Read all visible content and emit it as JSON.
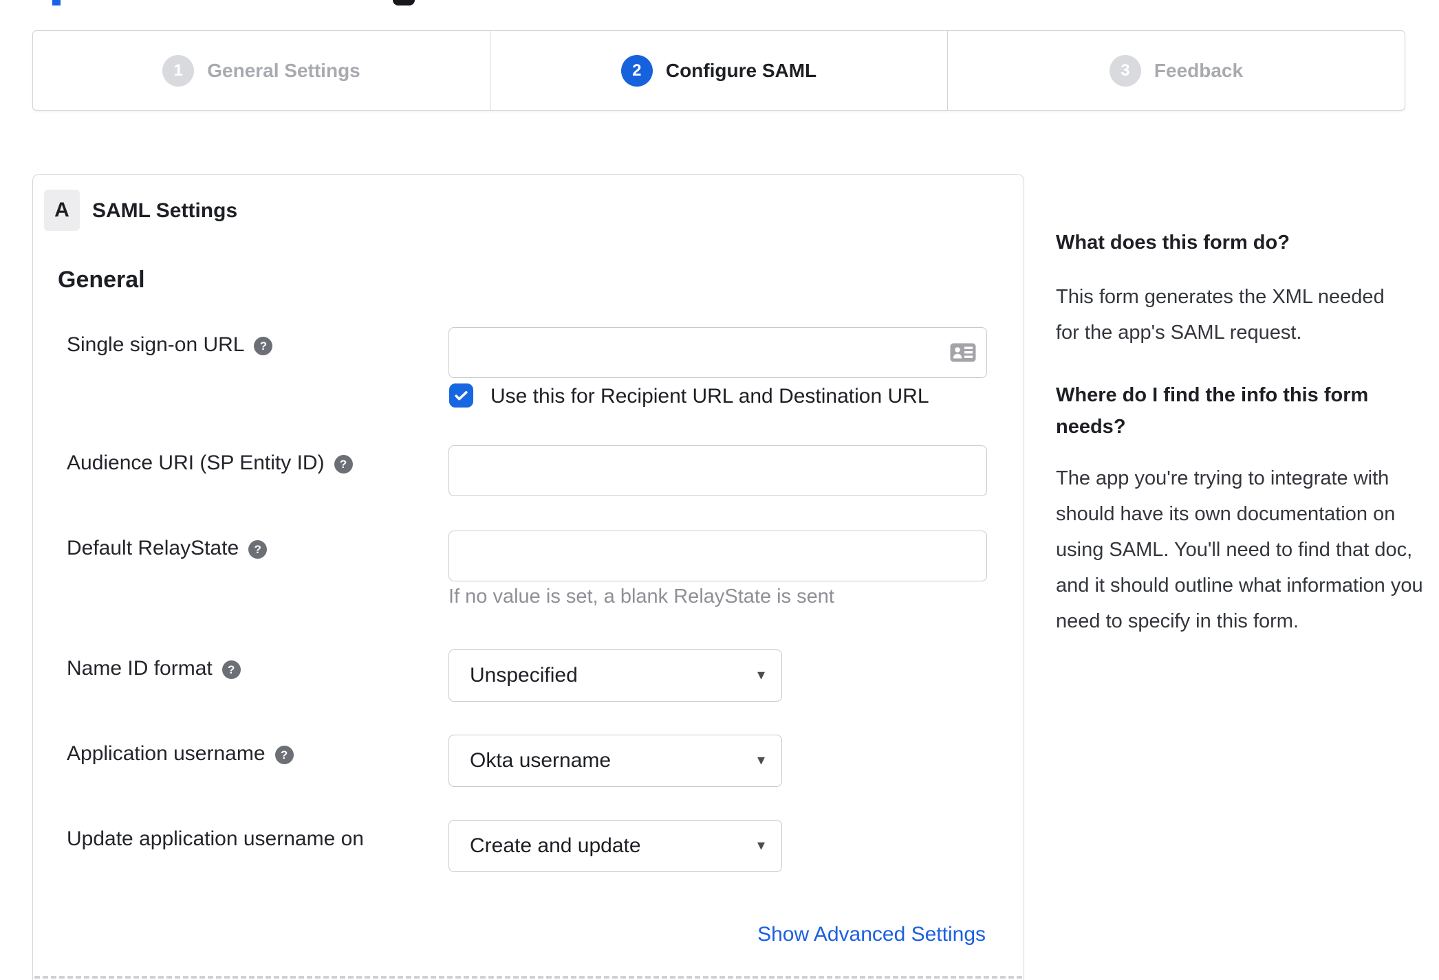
{
  "stepper": {
    "steps": [
      {
        "number": "1",
        "label": "General Settings",
        "state": "inactive"
      },
      {
        "number": "2",
        "label": "Configure SAML",
        "state": "active"
      },
      {
        "number": "3",
        "label": "Feedback",
        "state": "inactive"
      }
    ]
  },
  "panel": {
    "section_badge": "A",
    "section_title": "SAML Settings",
    "group_heading": "General",
    "sso": {
      "label": "Single sign-on URL",
      "value": "",
      "checkbox_label": "Use this for Recipient URL and Destination URL",
      "checkbox_checked": true
    },
    "audience": {
      "label": "Audience URI (SP Entity ID)",
      "value": ""
    },
    "relay": {
      "label": "Default RelayState",
      "value": "",
      "helper": "If no value is set, a blank RelayState is sent"
    },
    "name_id": {
      "label": "Name ID format",
      "value": "Unspecified"
    },
    "app_username": {
      "label": "Application username",
      "value": "Okta username"
    },
    "update_username": {
      "label": "Update application username on",
      "value": "Create and update"
    },
    "advanced_link": "Show Advanced Settings",
    "help_glyph": "?"
  },
  "sidebar": {
    "q1": "What does this form do?",
    "a1": "This form generates the XML needed for the app's SAML request.",
    "q2": "Where do I find the info this form needs?",
    "a2": "The app you're trying to integrate with should have its own documentation on using SAML. You'll need to find that doc, and it should outline what information you need to specify in this form."
  },
  "colors": {
    "accent_blue": "#1662dd",
    "checkbox_blue": "#1766e2",
    "link_blue": "#1c60e0",
    "inactive_gray": "#d8dadd",
    "border_gray": "#d4d4d9"
  }
}
